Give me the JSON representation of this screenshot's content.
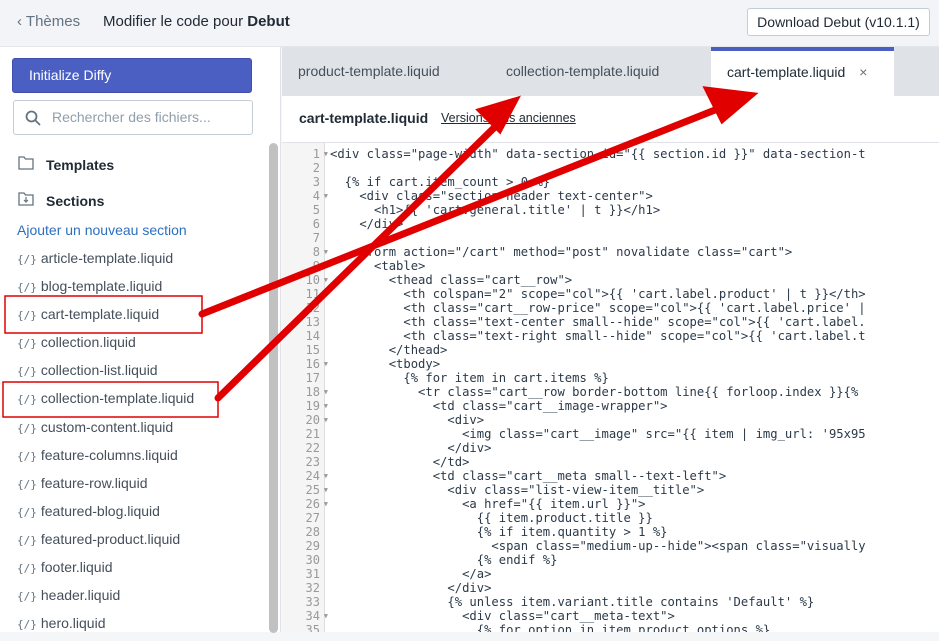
{
  "header": {
    "back": "Thèmes",
    "title_prefix": "Modifier le code pour ",
    "title_theme": "Debut",
    "download": "Download Debut (v10.1.1)"
  },
  "sidebar": {
    "diffy": "Initialize Diffy",
    "search_placeholder": "Rechercher des fichiers...",
    "templates": "Templates",
    "sections": "Sections",
    "add_section": "Ajouter un nouveau section",
    "file_icon": "{/}",
    "files": [
      "article-template.liquid",
      "blog-template.liquid",
      "cart-template.liquid",
      "collection.liquid",
      "collection-list.liquid",
      "collection-template.liquid",
      "custom-content.liquid",
      "feature-columns.liquid",
      "feature-row.liquid",
      "featured-blog.liquid",
      "featured-product.liquid",
      "footer.liquid",
      "header.liquid",
      "hero.liquid"
    ],
    "highlighted": [
      "cart-template.liquid",
      "collection-template.liquid"
    ]
  },
  "tabs": [
    {
      "label": "product-template.liquid"
    },
    {
      "label": "collection-template.liquid"
    },
    {
      "label": "cart-template.liquid",
      "active": true,
      "close": "×"
    }
  ],
  "editor": {
    "filename": "cart-template.liquid",
    "versions": "Versions plus anciennes",
    "folds": [
      1,
      4,
      8,
      9,
      10,
      16,
      18,
      19,
      20,
      24,
      25,
      26,
      34
    ],
    "lines": [
      "<div class=\"page-width\" data-section-id=\"{{ section.id }}\" data-section-t",
      "",
      "  {% if cart.item_count > 0 %}",
      "    <div class=\"section-header text-center\">",
      "      <h1>{{ 'cart.general.title' | t }}</h1>",
      "    </div>",
      "",
      "    <form action=\"/cart\" method=\"post\" novalidate class=\"cart\">",
      "      <table>",
      "        <thead class=\"cart__row\">",
      "          <th colspan=\"2\" scope=\"col\">{{ 'cart.label.product' | t }}</th>",
      "          <th class=\"cart__row-price\" scope=\"col\">{{ 'cart.label.price' |",
      "          <th class=\"text-center small--hide\" scope=\"col\">{{ 'cart.label.",
      "          <th class=\"text-right small--hide\" scope=\"col\">{{ 'cart.label.t",
      "        </thead>",
      "        <tbody>",
      "          {% for item in cart.items %}",
      "            <tr class=\"cart__row border-bottom line{{ forloop.index }}{%",
      "              <td class=\"cart__image-wrapper\">",
      "                <div>",
      "                  <img class=\"cart__image\" src=\"{{ item | img_url: '95x95",
      "                </div>",
      "              </td>",
      "              <td class=\"cart__meta small--text-left\">",
      "                <div class=\"list-view-item__title\">",
      "                  <a href=\"{{ item.url }}\">",
      "                    {{ item.product.title }}",
      "                    {% if item.quantity > 1 %}",
      "                      <span class=\"medium-up--hide\"><span class=\"visually",
      "                    {% endif %}",
      "                  </a>",
      "                </div>",
      "                {% unless item.variant.title contains 'Default' %}",
      "                  <div class=\"cart__meta-text\">",
      "                    {% for option in item.product.options %}"
    ]
  },
  "colors": {
    "accent": "#4a5fc1",
    "annotation": "#e00000"
  }
}
